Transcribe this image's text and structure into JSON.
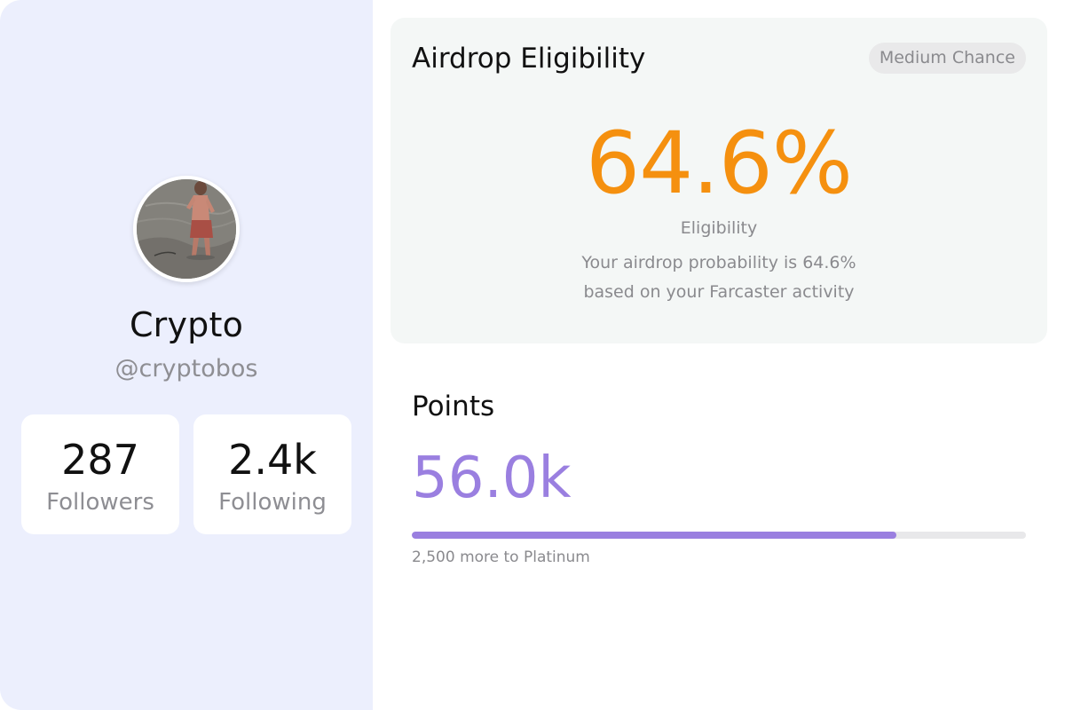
{
  "profile": {
    "display_name": "Crypto",
    "handle": "@cryptobos",
    "avatar_icon": "profile-photo",
    "stats": [
      {
        "value": "287",
        "label": "Followers"
      },
      {
        "value": "2.4k",
        "label": "Following"
      }
    ]
  },
  "eligibility": {
    "title": "Airdrop Eligibility",
    "badge": "Medium Chance",
    "percentage": "64.6%",
    "label": "Eligibility",
    "description_line1": "Your airdrop probability is 64.6%",
    "description_line2": "based on your Farcaster activity"
  },
  "points": {
    "title": "Points",
    "value": "56.0k",
    "progress_fraction": 0.789,
    "caption": "2,500 more to Platinum"
  },
  "colors": {
    "sidebar_bg": "#eceffd",
    "eligibility_accent": "#f5900f",
    "points_accent": "#9a7fe0"
  }
}
